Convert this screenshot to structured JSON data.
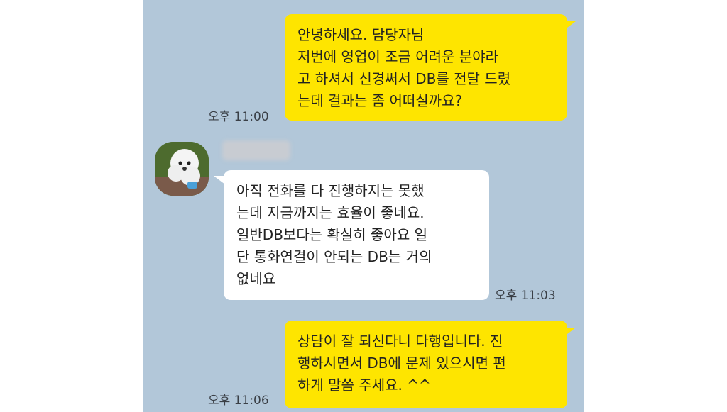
{
  "messages": [
    {
      "sender": "me",
      "lines": [
        "안녕하세요. 담당자님",
        "저번에 영업이 조금 어려운 분야라",
        "고 하셔서 신경써서 DB를 전달 드렸",
        "는데 결과는 좀 어떠실까요?"
      ],
      "time": "오후 11:00"
    },
    {
      "sender": "other",
      "lines": [
        "아직 전화를 다 진행하지는 못했",
        "는데 지금까지는 효율이 좋네요.",
        "일반DB보다는 확실히 좋아요 일",
        "단 통화연결이 안되는 DB는 거의",
        "없네요"
      ],
      "time": "오후 11:03"
    },
    {
      "sender": "me",
      "lines": [
        "상담이 잘 되신다니 다행입니다. 진",
        "행하시면서 DB에 문제 있으시면 편",
        "하게 말씀 주세요. ^^"
      ],
      "time": "오후 11:06"
    }
  ],
  "colors": {
    "chat_background": "#b2c7d9",
    "my_bubble": "#fee500",
    "other_bubble": "#ffffff"
  }
}
